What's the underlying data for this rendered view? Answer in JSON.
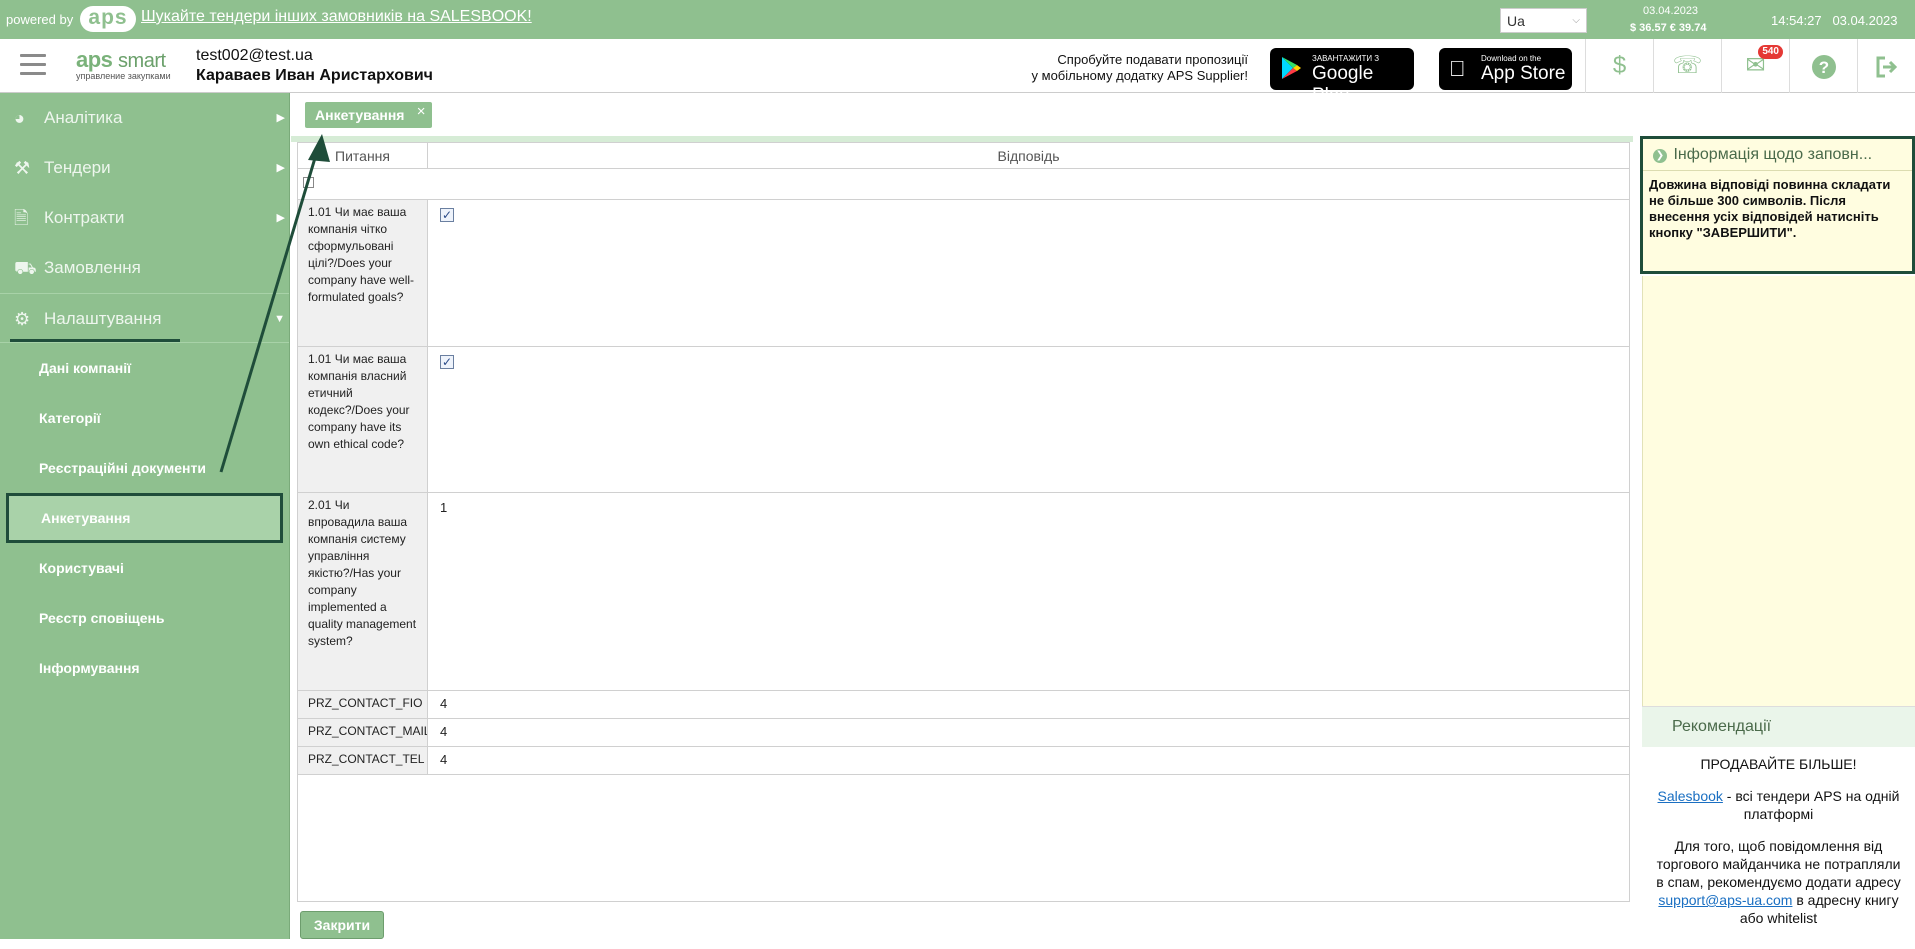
{
  "topbar": {
    "powered": "powered by",
    "logo": "aps",
    "promo": "Шукайте тендери інших замовників на SALESBOOK!",
    "lang": "Ua",
    "rate_date": "03.04.2023",
    "rates": "$ 36.57  € 39.74",
    "time": "14:54:27",
    "date": "03.04.2023"
  },
  "header": {
    "logo_main": "aps",
    "logo_sub": "smart",
    "logo_tag": "управление закупками",
    "email": "test002@test.ua",
    "user_name": "Караваев Иван Аристархович",
    "promo_line1": "Спробуйте подавати пропозиції",
    "promo_line2": "у мобільному додатку APS Supplier!",
    "google_small": "ЗАВАНТАЖИТИ З",
    "google_big": "Google Play",
    "apple_small": "Download on the",
    "apple_big": "App Store",
    "mail_badge": "540"
  },
  "sidebar": {
    "items": [
      {
        "label": "Аналітика",
        "icon": "pie-chart-icon"
      },
      {
        "label": "Тендери",
        "icon": "gavel-icon"
      },
      {
        "label": "Контракти",
        "icon": "document-icon"
      },
      {
        "label": "Замовлення",
        "icon": "truck-icon"
      },
      {
        "label": "Налаштування",
        "icon": "gears-icon"
      }
    ],
    "sub_items": [
      "Дані компанії",
      "Категорії",
      "Реєстраційні документи",
      "Анкетування",
      "Користувачі",
      "Реєстр сповіщень",
      "Інформування"
    ]
  },
  "tab": {
    "label": "Анкетування"
  },
  "grid": {
    "col_question": "Питання",
    "col_answer": "Відповідь",
    "rows": [
      {
        "q": "1.01 Чи має ваша компанія чітко сформульовані цілі?/Does your company have well-formulated goals?",
        "a": "",
        "checkbox": true
      },
      {
        "q": "1.01 Чи має ваша компанія власний етичний кодекс?/Does your company have its own ethical code?",
        "a": "",
        "checkbox": true
      },
      {
        "q": "2.01 Чи впровадила ваша компанія систему управління якістю?/Has your company implemented a quality management system?",
        "a": "1",
        "checkbox": false
      },
      {
        "q": "PRZ_CONTACT_FIO",
        "a": "4",
        "checkbox": false
      },
      {
        "q": "PRZ_CONTACT_MAIL",
        "a": "4",
        "checkbox": false
      },
      {
        "q": "PRZ_CONTACT_TEL",
        "a": "4",
        "checkbox": false
      }
    ]
  },
  "close_button": "Закрити",
  "info": {
    "title": "Інформація щодо заповн...",
    "body": "Довжина відповіді повинна складати не більше 300 символів. Після внесення усіх відповідей натисніть кнопку \"ЗАВЕРШИТИ\"."
  },
  "reco": {
    "title": "Рекомендації",
    "headline": "ПРОДАВАЙТЕ БІЛЬШЕ!",
    "salesbook_link": "Salesbook",
    "salesbook_text": " - всі тендери APS на одній платформі",
    "spam_text_1": "Для того, щоб повідомлення від торгового майданчика не потрапляли в спам, рекомендуємо додати адресу ",
    "spam_link": "support@aps-ua.com",
    "spam_text_2": " в адресну книгу або whitelist"
  },
  "colors": {
    "brand_green": "#8fc08f",
    "annotation_dark": "#1f4d3a",
    "info_bg": "#fffde0"
  }
}
